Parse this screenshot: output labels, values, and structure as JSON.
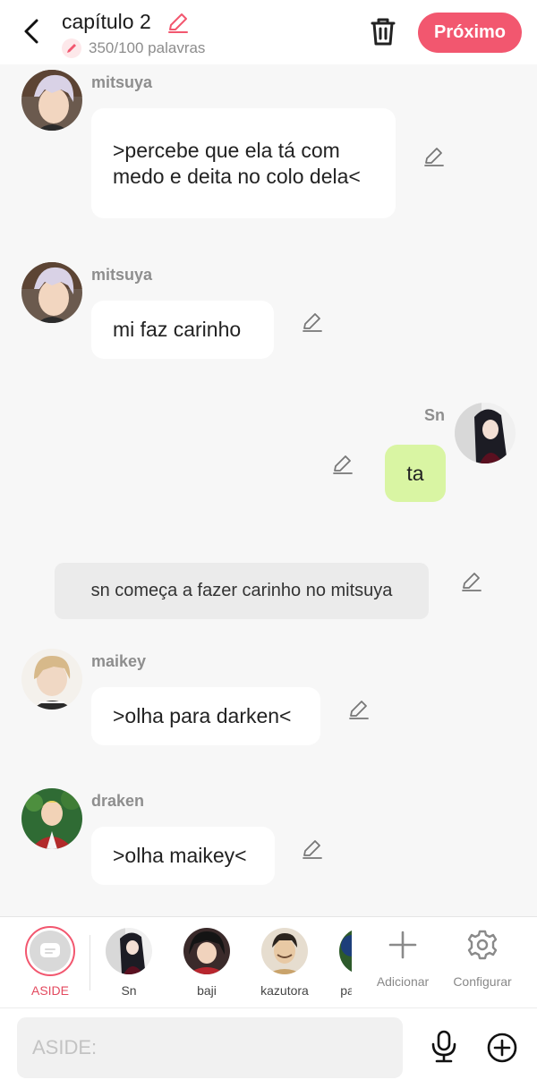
{
  "header": {
    "title": "capítulo 2",
    "word_count": "350/100 palavras",
    "next_label": "Próximo"
  },
  "messages": [
    {
      "name": "mitsuya",
      "text": ">percebe que ela tá com medo e deita no colo dela<"
    },
    {
      "name": "mitsuya",
      "text": "mi faz carinho"
    },
    {
      "name": "Sn",
      "text": "ta"
    },
    {
      "aside": "sn começa a fazer carinho no mitsuya"
    },
    {
      "name": "maikey",
      "text": ">olha para darken<"
    },
    {
      "name": "draken",
      "text": ">olha maikey<"
    }
  ],
  "characters": [
    {
      "label": "ASIDE"
    },
    {
      "label": "Sn"
    },
    {
      "label": "baji"
    },
    {
      "label": "kazutora"
    },
    {
      "label": "pa"
    }
  ],
  "tools": {
    "add_label": "Adicionar",
    "settings_label": "Configurar"
  },
  "composer": {
    "placeholder": "ASIDE:"
  },
  "colors": {
    "accent": "#f2576f",
    "my_bubble": "#d9f5a3",
    "aside_bubble": "#ebebeb",
    "background": "#f7f7f7"
  }
}
